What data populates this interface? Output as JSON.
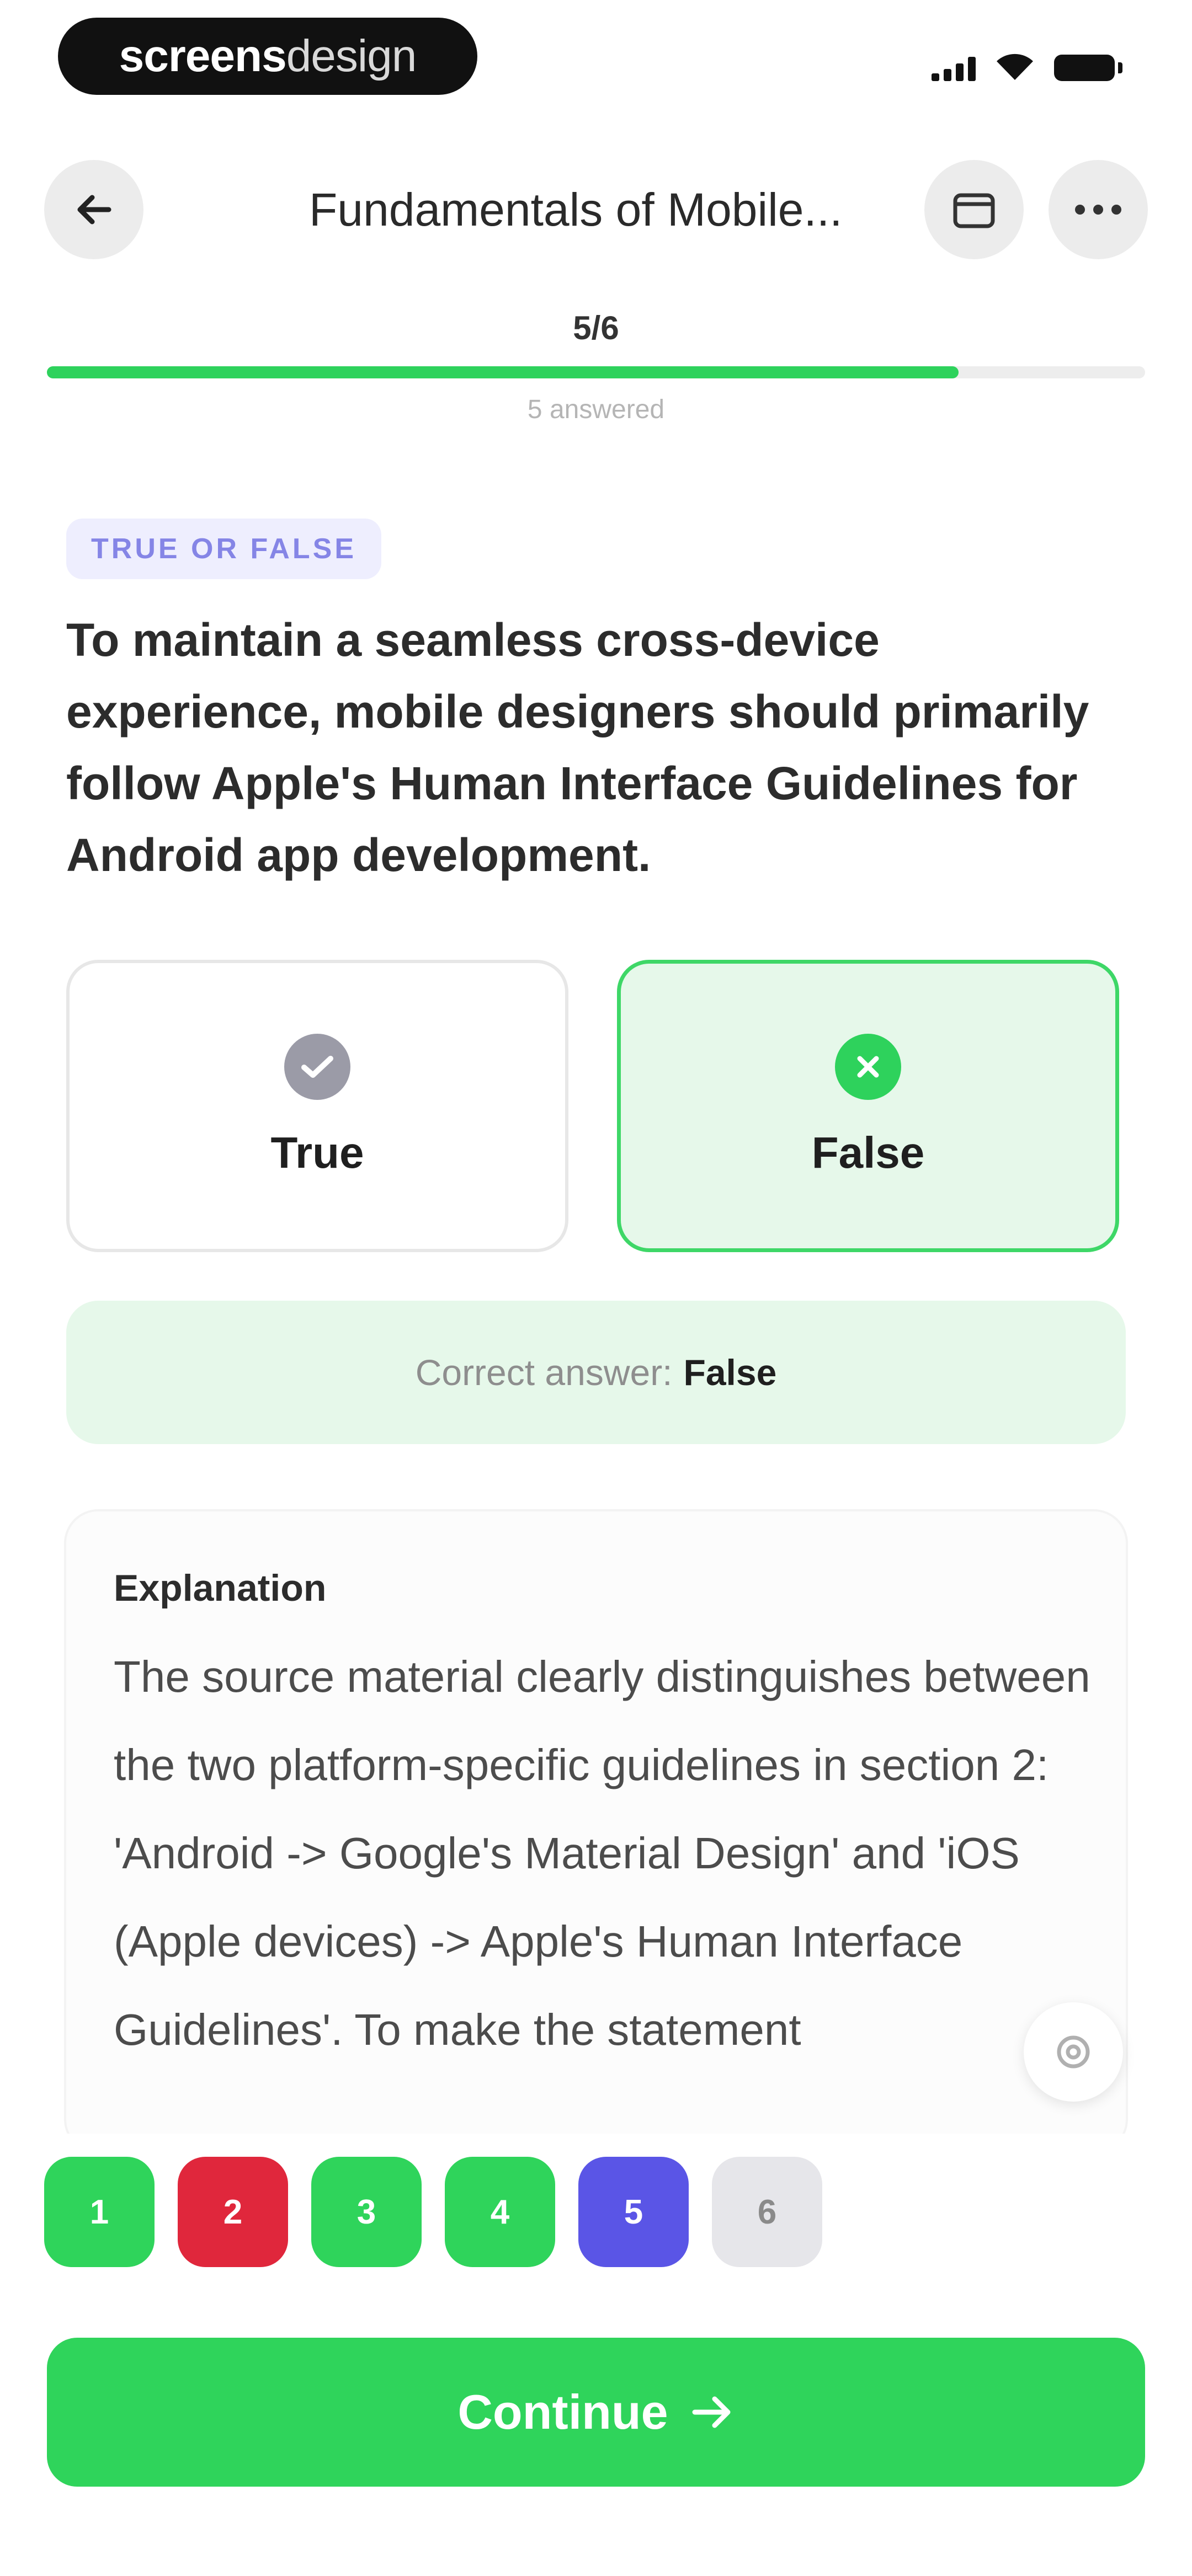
{
  "status_bar": {
    "brand_bold": "screens",
    "brand_light": "design"
  },
  "header": {
    "title": "Fundamentals of Mobile..."
  },
  "progress": {
    "count_label": "5/6",
    "answered_label": "5 answered",
    "fraction": 0.83
  },
  "question": {
    "type_badge": "TRUE OR FALSE",
    "text": "To maintain a seamless cross-device experience, mobile designers should primarily follow Apple's Human Interface Guidelines for Android app development."
  },
  "options": [
    {
      "label": "True",
      "state": "unselected"
    },
    {
      "label": "False",
      "state": "selected-correct"
    }
  ],
  "result": {
    "label": "Correct answer:",
    "value": "False"
  },
  "explanation": {
    "title": "Explanation",
    "text": "The source material clearly distinguishes between the two platform-specific guidelines in section 2: 'Android -> Google's Material Design' and 'iOS (Apple devices) -> Apple's Human Interface Guidelines'. To make the statement"
  },
  "question_nav": [
    {
      "label": "1",
      "status": "correct"
    },
    {
      "label": "2",
      "status": "incorrect"
    },
    {
      "label": "3",
      "status": "correct"
    },
    {
      "label": "4",
      "status": "correct"
    },
    {
      "label": "5",
      "status": "current"
    },
    {
      "label": "6",
      "status": "unanswered"
    }
  ],
  "continue_label": "Continue",
  "colors": {
    "accent_green": "#2fd45b",
    "error_red": "#e0273c",
    "current_purple": "#5a55e6",
    "neutral_gray": "#e6e6ea",
    "badge_text": "#8585e6"
  }
}
